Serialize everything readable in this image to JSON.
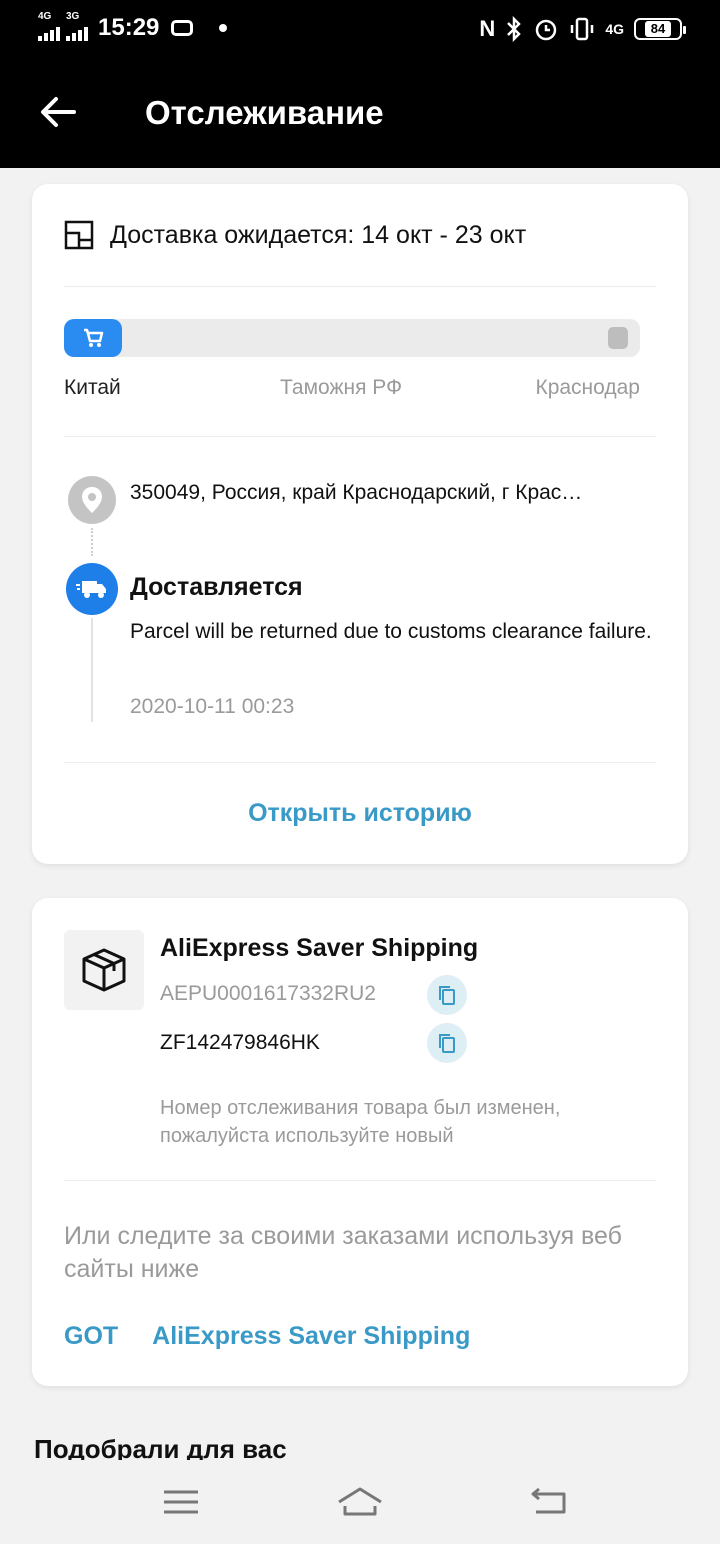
{
  "status_bar": {
    "time": "15:29",
    "signal_1": "4G",
    "signal_2": "3G",
    "network_right": "4G",
    "battery": "84"
  },
  "header": {
    "title": "Отслеживание"
  },
  "delivery": {
    "eta": "Доставка ожидается: 14 окт - 23 окт",
    "progress_fraction": 0.1,
    "stages": [
      "Китай",
      "Таможня РФ",
      "Краснодар"
    ],
    "address": "350049,  Россия, край Краснодарский, г Крас…",
    "event": {
      "title": "Доставляется",
      "description": "Parcel will be returned due to customs clearance failure.",
      "time": "2020-10-11 00:23"
    },
    "history_link": "Открыть историю"
  },
  "shipment": {
    "carrier": "AliExpress Saver Shipping",
    "tracking_old": "AEPU0001617332RU2",
    "tracking_new": "ZF142479846HK",
    "note": "Номер отслеживания товара был изменен, пожалуйста используйте новый",
    "web_text": "Или следите за своими заказами используя веб сайты ниже",
    "links": [
      "GOT",
      "AliExpress Saver Shipping"
    ]
  },
  "recommend_title": "Подобрали для вас",
  "colors": {
    "accent": "#3a9ac7",
    "progress": "#2a8cf0",
    "truck": "#1f7fe8"
  }
}
